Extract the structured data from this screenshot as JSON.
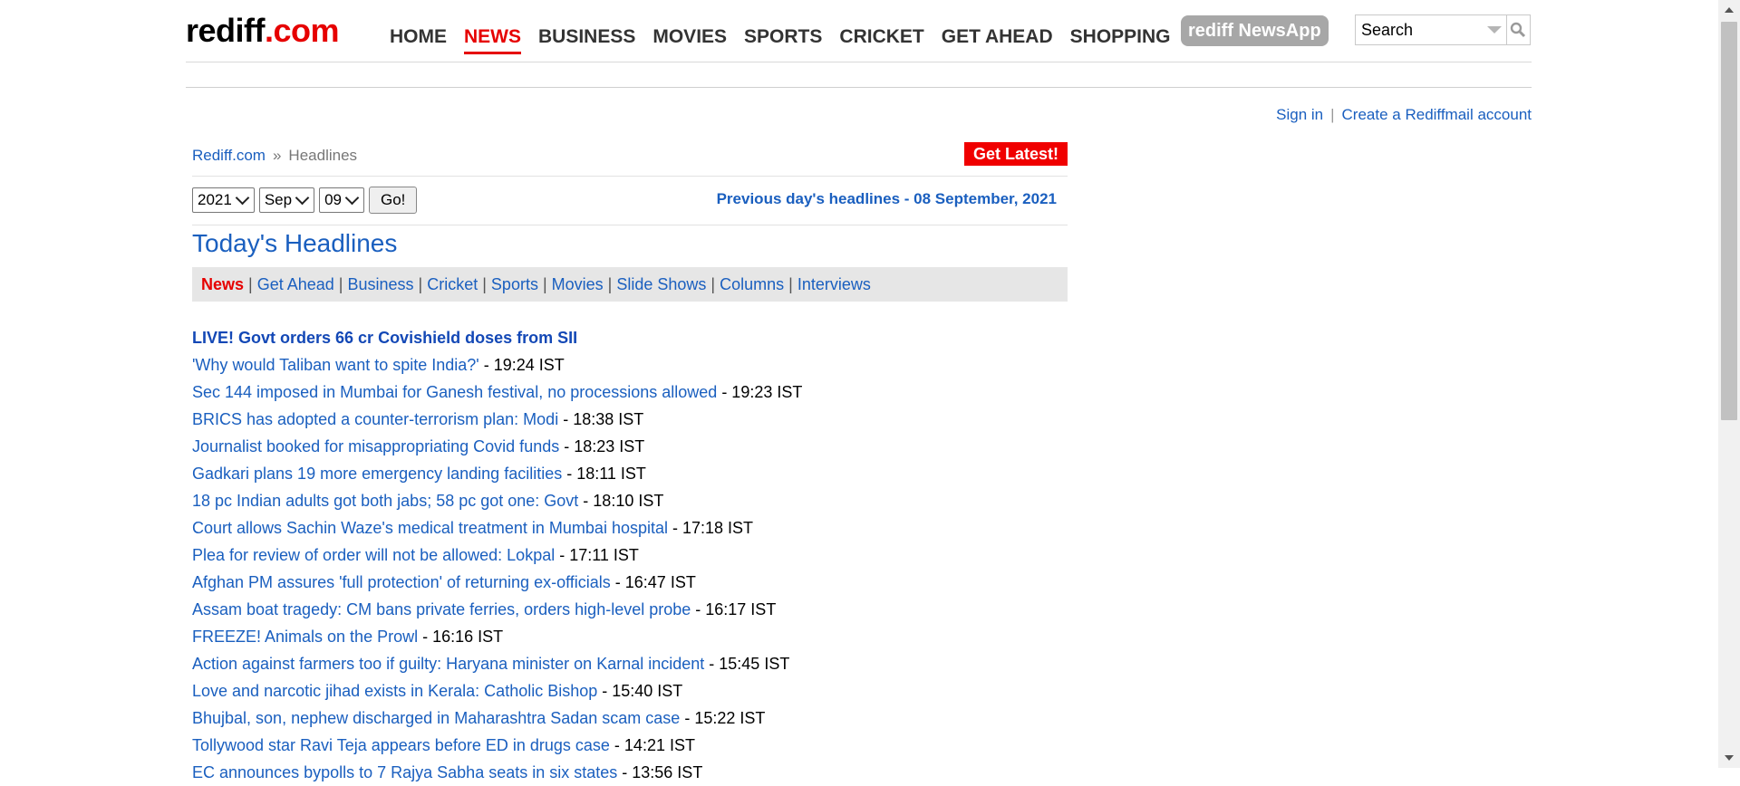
{
  "header": {
    "logo_part1": "rediff",
    "logo_part2": ".com",
    "nav": [
      "HOME",
      "NEWS",
      "BUSINESS",
      "MOVIES",
      "SPORTS",
      "CRICKET",
      "GET AHEAD",
      "SHOPPING"
    ],
    "newsapp": "rediff NewsApp",
    "search_value": "Search"
  },
  "account": {
    "sign_in": "Sign in",
    "separator": "|",
    "create": "Create a Rediffmail account"
  },
  "breadcrumb": {
    "home": "Rediff.com",
    "separator": "»",
    "current": "Headlines"
  },
  "get_latest": "Get Latest!",
  "date_form": {
    "year": "2021",
    "month": "Sep",
    "day": "09",
    "go": "Go!"
  },
  "previous_link": "Previous day's headlines - 08 September, 2021",
  "page_title": "Today's Headlines",
  "tabs": [
    "News",
    "Get Ahead",
    "Business",
    "Cricket",
    "Sports",
    "Movies",
    "Slide Shows",
    "Columns",
    "Interviews"
  ],
  "tab_separator": "|",
  "lead_headline": "LIVE! Govt orders 66 cr Covishield doses from SII",
  "headlines": [
    {
      "title": "'Why would Taliban want to spite India?'",
      "time": " - 19:24 IST"
    },
    {
      "title": "Sec 144 imposed in Mumbai for Ganesh festival, no processions allowed",
      "time": " - 19:23 IST"
    },
    {
      "title": "BRICS has adopted a counter-terrorism plan: Modi",
      "time": " - 18:38 IST"
    },
    {
      "title": "Journalist booked for misappropriating Covid funds",
      "time": " - 18:23 IST"
    },
    {
      "title": "Gadkari plans 19 more emergency landing facilities",
      "time": " - 18:11 IST"
    },
    {
      "title": "18 pc Indian adults got both jabs; 58 pc got one: Govt",
      "time": " - 18:10 IST"
    },
    {
      "title": "Court allows Sachin Waze's medical treatment in Mumbai hospital",
      "time": " - 17:18 IST"
    },
    {
      "title": "Plea for review of order will not be allowed: Lokpal",
      "time": " - 17:11 IST"
    },
    {
      "title": "Afghan PM assures 'full protection' of returning ex-officials",
      "time": " - 16:47 IST"
    },
    {
      "title": "Assam boat tragedy: CM bans private ferries, orders high-level probe",
      "time": " - 16:17 IST"
    },
    {
      "title": "FREEZE! Animals on the Prowl",
      "time": " - 16:16 IST"
    },
    {
      "title": "Action against farmers too if guilty: Haryana minister on Karnal incident",
      "time": " - 15:45 IST"
    },
    {
      "title": "Love and narcotic jihad exists in Kerala: Catholic Bishop",
      "time": " - 15:40 IST"
    },
    {
      "title": "Bhujbal, son, nephew discharged in Maharashtra Sadan scam case",
      "time": " - 15:22 IST"
    },
    {
      "title": "Tollywood star Ravi Teja appears before ED in drugs case",
      "time": " - 14:21 IST"
    },
    {
      "title": "EC announces bypolls to 7 Rajya Sabha seats in six states",
      "time": " - 13:56 IST"
    }
  ],
  "colors": {
    "brand_red": "#e60000",
    "link_blue": "#1a5fbf"
  }
}
